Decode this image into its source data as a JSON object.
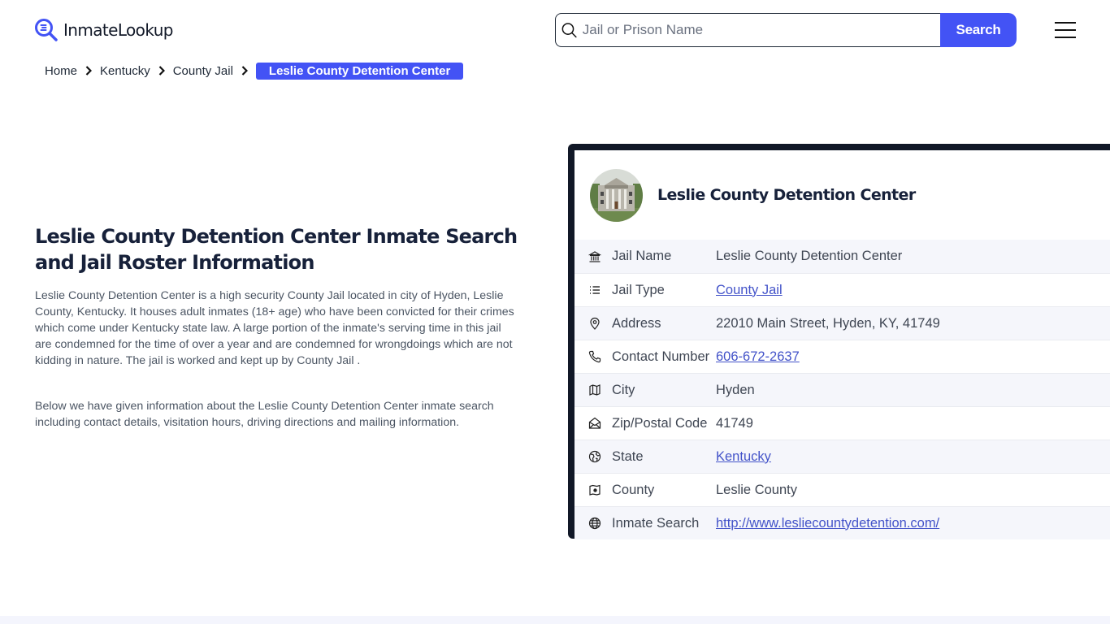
{
  "header": {
    "logo_text": "InmateLookup",
    "search": {
      "placeholder": "Jail or Prison Name",
      "value": "",
      "button_label": "Search",
      "icon": "search-icon"
    },
    "menu_icon": "hamburger-menu-icon"
  },
  "breadcrumb": {
    "items": [
      {
        "label": "Home"
      },
      {
        "label": "Kentucky"
      },
      {
        "label": "County Jail"
      }
    ],
    "current": "Leslie County Detention Center"
  },
  "main": {
    "title": "Leslie County Detention Center Inmate Search and Jail Roster Information",
    "paragraphs": [
      "Leslie County Detention Center is a high security County Jail located in city of Hyden, Leslie County, Kentucky. It houses adult inmates (18+ age) who have been convicted for their crimes which come under Kentucky state law. A large portion of the inmate's serving time in this jail are condemned for the time of over a year and are condemned for wrongdoings which are not kidding in nature. The jail is worked and kept up by County Jail .",
      "Below we have given information about the Leslie County Detention Center inmate search including contact details, visitation hours, driving directions and mailing information."
    ]
  },
  "card": {
    "title": "Leslie County Detention Center",
    "photo_alt": "Leslie County Detention Center building",
    "rows": [
      {
        "icon": "bank-icon",
        "label": "Jail Name",
        "value": "Leslie County Detention Center",
        "link": false
      },
      {
        "icon": "list-icon",
        "label": "Jail Type",
        "value": "County Jail",
        "link": true
      },
      {
        "icon": "map-pin-icon",
        "label": "Address",
        "value": "22010 Main Street, Hyden, KY, 41749",
        "link": false
      },
      {
        "icon": "phone-icon",
        "label": "Contact Number",
        "value": "606-672-2637",
        "link": true
      },
      {
        "icon": "map-icon",
        "label": "City",
        "value": "Hyden",
        "link": false
      },
      {
        "icon": "mail-open-icon",
        "label": "Zip/Postal Code",
        "value": "41749",
        "link": false
      },
      {
        "icon": "earth-icon",
        "label": "State",
        "value": "Kentucky",
        "link": true
      },
      {
        "icon": "county-map-icon",
        "label": "County",
        "value": "Leslie County",
        "link": false
      },
      {
        "icon": "globe-icon",
        "label": "Inmate Search",
        "value": "http://www.lesliecountydetention.com/",
        "link": true
      }
    ]
  },
  "colors": {
    "brand": "#4353f5",
    "card_border": "#111827",
    "link": "#4353c9",
    "heading": "#17213a"
  }
}
